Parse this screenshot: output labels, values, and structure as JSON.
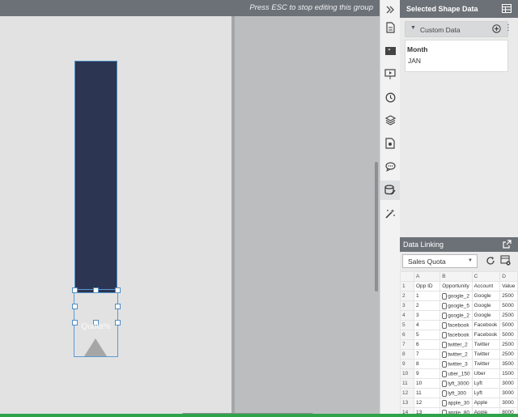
{
  "canvas": {
    "banner_text": "Press ESC to stop editing this group",
    "selected_group": {
      "label": "Quota%"
    }
  },
  "rail": {
    "icons": [
      "collapse-panel-icon",
      "page-icon",
      "quote-icon",
      "presentation-icon",
      "history-icon",
      "layers-icon",
      "shape-data-doc-icon",
      "comments-icon",
      "data-icon",
      "magic-wand-icon"
    ],
    "active": "data-icon"
  },
  "panel": {
    "title": "Selected Shape Data",
    "custom_data": {
      "label": "Custom Data"
    },
    "field": {
      "name": "Month",
      "value": "JAN"
    }
  },
  "data_linking": {
    "title": "Data Linking",
    "source": "Sales Quota",
    "columns": [
      "A",
      "B",
      "C",
      "D"
    ],
    "rows": [
      [
        "1",
        "Opp ID",
        "Opportunity",
        "Account",
        "Value"
      ],
      [
        "2",
        "1",
        "google_2",
        "Google",
        "2500"
      ],
      [
        "3",
        "2",
        "google_5",
        "Google",
        "5000"
      ],
      [
        "4",
        "3",
        "google_2",
        "Google",
        "2500"
      ],
      [
        "5",
        "4",
        "facebook",
        "Facebook",
        "5000"
      ],
      [
        "6",
        "5",
        "facebook",
        "Facebook",
        "5000"
      ],
      [
        "7",
        "6",
        "twitter_2",
        "Twitter",
        "2500"
      ],
      [
        "8",
        "7",
        "twitter_2",
        "Twitter",
        "2500"
      ],
      [
        "9",
        "8",
        "twitter_3",
        "Twitter",
        "3500"
      ],
      [
        "10",
        "9",
        "uber_150",
        "Uber",
        "1500"
      ],
      [
        "11",
        "10",
        "lyft_3000",
        "Lyft",
        "3000"
      ],
      [
        "12",
        "11",
        "lyft_300",
        "Lyft",
        "3000"
      ],
      [
        "13",
        "12",
        "apple_30",
        "Apple",
        "3000"
      ],
      [
        "14",
        "13",
        "apple_80",
        "Apple",
        "8000"
      ]
    ]
  },
  "colors": {
    "bar": "#2c3552",
    "header": "#6c7177",
    "selection": "#4d8fc7"
  }
}
